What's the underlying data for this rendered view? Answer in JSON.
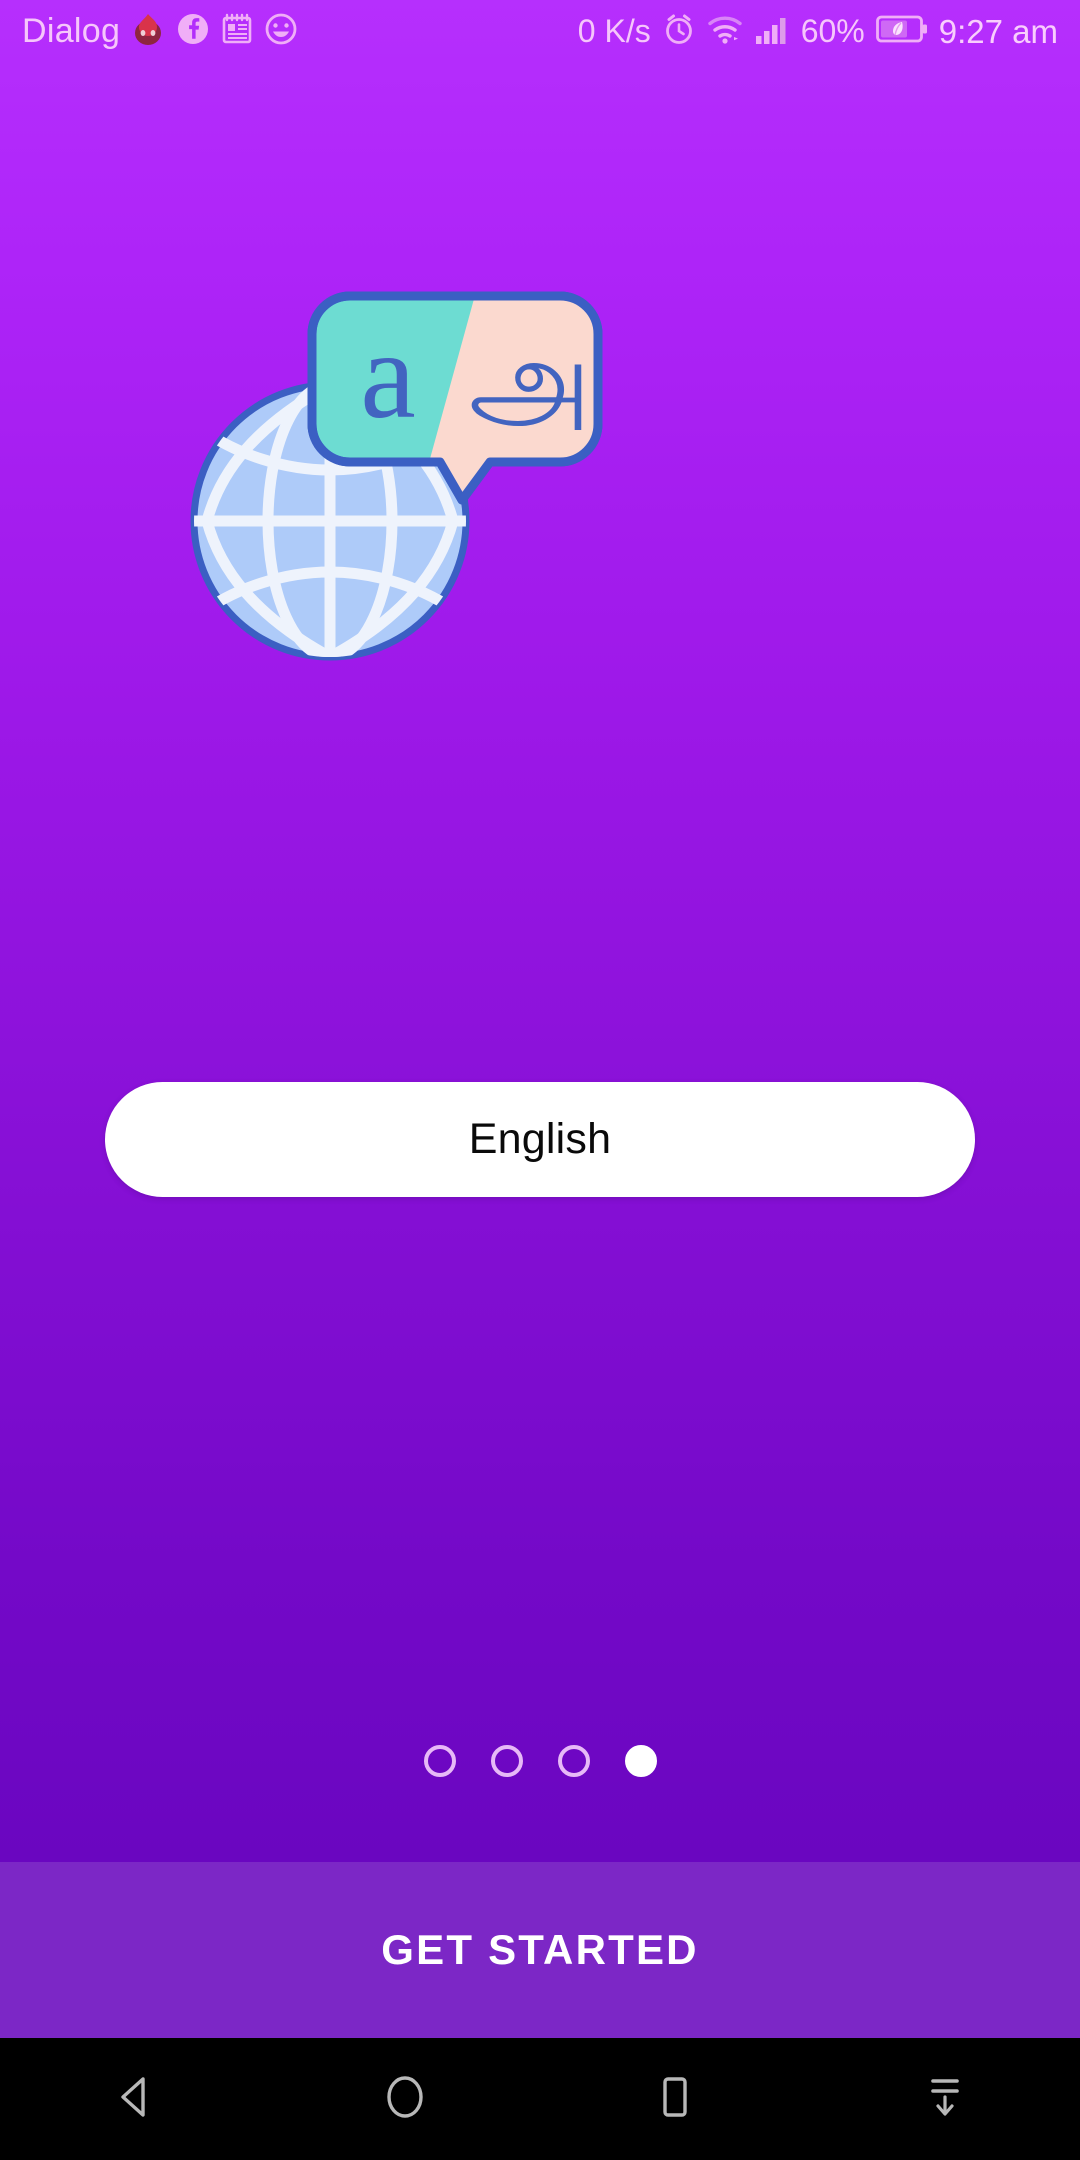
{
  "status_bar": {
    "carrier": "Dialog",
    "left_icons": [
      "flame-app-icon",
      "facebook-icon",
      "notepad-icon",
      "smiley-icon"
    ],
    "network_speed": "0 K/s",
    "right_icons": [
      "alarm-clock-icon",
      "wifi-icon",
      "signal-bars-icon",
      "battery-saver-icon"
    ],
    "battery_percent": "60%",
    "time": "9:27 am"
  },
  "illustration": {
    "name": "globe-translate-illustration",
    "globe_fill": "#aecbf9",
    "globe_outline": "#3b5fc3",
    "globe_lines": "#eef3fc",
    "bubble_left_fill": "#6ddcd2",
    "bubble_right_fill": "#fbd9cf",
    "bubble_outline": "#3b5fc3",
    "left_glyph": "a",
    "right_glyph": "அ",
    "glyph_color": "#4264c0"
  },
  "language_selector": {
    "name": "language-select-button",
    "value": "English",
    "background": "#ffffff",
    "text_color": "#0a0a0a"
  },
  "pager": {
    "total": 4,
    "active_index": 3,
    "inactive_color": "#e7b9f7",
    "active_color": "#ffffff"
  },
  "cta": {
    "label": "GET STARTED",
    "background": "#7c27c6",
    "text_color": "#ffffff"
  },
  "nav_bar": {
    "background": "#000000",
    "icon_color": "#b8b8b8",
    "buttons": [
      {
        "name": "nav-back-button",
        "icon": "back-triangle-icon"
      },
      {
        "name": "nav-home-button",
        "icon": "home-circle-icon"
      },
      {
        "name": "nav-recents-button",
        "icon": "recents-square-icon"
      },
      {
        "name": "nav-pulldown-button",
        "icon": "notification-pulldown-icon"
      }
    ]
  },
  "theme": {
    "gradient_top": "#b62ffd",
    "gradient_bottom": "#6a06c0",
    "status_text": "#f6c6fb"
  }
}
